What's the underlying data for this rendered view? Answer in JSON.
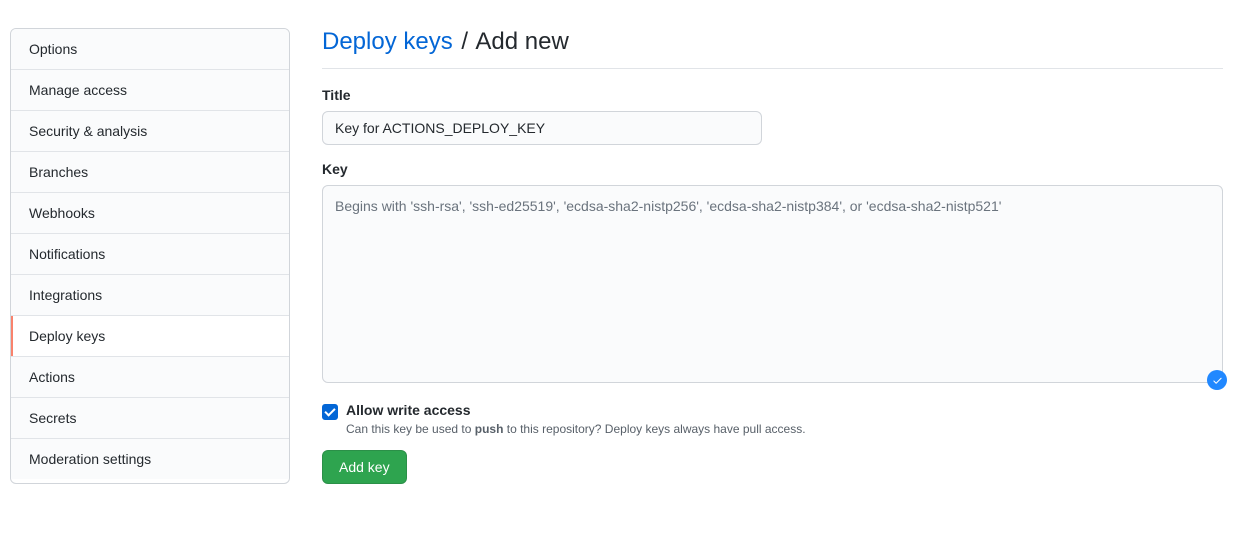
{
  "sidebar": {
    "items": [
      {
        "label": "Options"
      },
      {
        "label": "Manage access"
      },
      {
        "label": "Security & analysis"
      },
      {
        "label": "Branches"
      },
      {
        "label": "Webhooks"
      },
      {
        "label": "Notifications"
      },
      {
        "label": "Integrations"
      },
      {
        "label": "Deploy keys"
      },
      {
        "label": "Actions"
      },
      {
        "label": "Secrets"
      },
      {
        "label": "Moderation settings"
      }
    ]
  },
  "header": {
    "link_text": "Deploy keys",
    "separator": "/",
    "sub_text": "Add new"
  },
  "form": {
    "title_label": "Title",
    "title_value": "Key for ACTIONS_DEPLOY_KEY",
    "key_label": "Key",
    "key_placeholder": "Begins with 'ssh-rsa', 'ssh-ed25519', 'ecdsa-sha2-nistp256', 'ecdsa-sha2-nistp384', or 'ecdsa-sha2-nistp521'",
    "allow_write_label": "Allow write access",
    "allow_write_desc_prefix": "Can this key be used to ",
    "allow_write_desc_bold": "push",
    "allow_write_desc_suffix": " to this repository? Deploy keys always have pull access.",
    "submit_label": "Add key"
  }
}
